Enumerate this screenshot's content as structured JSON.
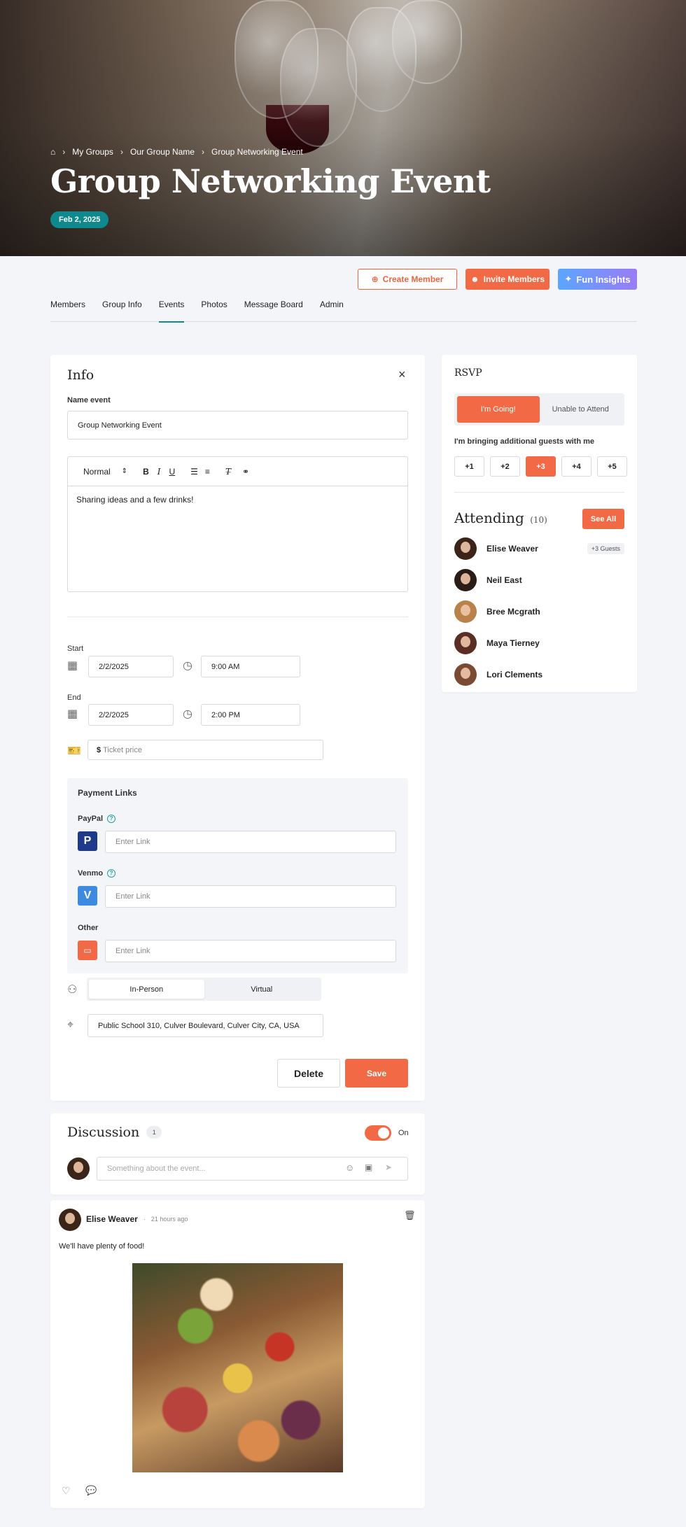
{
  "hero": {
    "breadcrumb": [
      "My Groups",
      "Our Group Name",
      "Group Networking Event"
    ],
    "title": "Group Networking Event",
    "date": "Feb 2, 2025"
  },
  "actions": {
    "create_member": "Create Member",
    "invite_members": "Invite Members",
    "fun_insights": "Fun Insights"
  },
  "tabs": [
    "Members",
    "Group Info",
    "Events",
    "Photos",
    "Message Board",
    "Admin"
  ],
  "active_tab": "Events",
  "info": {
    "title": "Info",
    "name_label": "Name event",
    "name_value": "Group Networking Event",
    "editor_style": "Normal",
    "editor_text": "Sharing ideas and a few drinks!",
    "start_label": "Start",
    "start_date": "2/2/2025",
    "start_time": "9:00 AM",
    "end_label": "End",
    "end_date": "2/2/2025",
    "end_time": "2:00 PM",
    "ticket_prefix": "$",
    "ticket_placeholder": "Ticket price",
    "payment_title": "Payment Links",
    "paypal_label": "PayPal",
    "venmo_label": "Venmo",
    "other_label": "Other",
    "link_placeholder": "Enter Link",
    "mode_options": [
      "In-Person",
      "Virtual"
    ],
    "location": "Public School 310, Culver Boulevard, Culver City, CA, USA",
    "delete": "Delete",
    "save": "Save"
  },
  "rsvp": {
    "title": "RSVP",
    "going": "I'm Going!",
    "unable": "Unable to Attend",
    "guests_prompt": "I'm bringing additional guests with me",
    "guest_options": [
      "+1",
      "+2",
      "+3",
      "+4",
      "+5"
    ],
    "selected_guests": "+3",
    "attending_title": "Attending",
    "attending_count": "(10)",
    "see_all": "See All",
    "attendees": [
      {
        "name": "Elise Weaver",
        "badge": "+3 Guests"
      },
      {
        "name": "Neil East",
        "badge": ""
      },
      {
        "name": "Bree Mcgrath",
        "badge": ""
      },
      {
        "name": "Maya Tierney",
        "badge": ""
      },
      {
        "name": "Lori Clements",
        "badge": ""
      }
    ]
  },
  "discussion": {
    "title": "Discussion",
    "count": "1",
    "toggle_label": "On",
    "placeholder": "Something about the event..."
  },
  "post": {
    "author": "Elise Weaver",
    "time": "21 hours ago",
    "text": "We'll have plenty of food!"
  },
  "colors": {
    "accent": "#f26a45",
    "teal": "#0e8a8f"
  }
}
